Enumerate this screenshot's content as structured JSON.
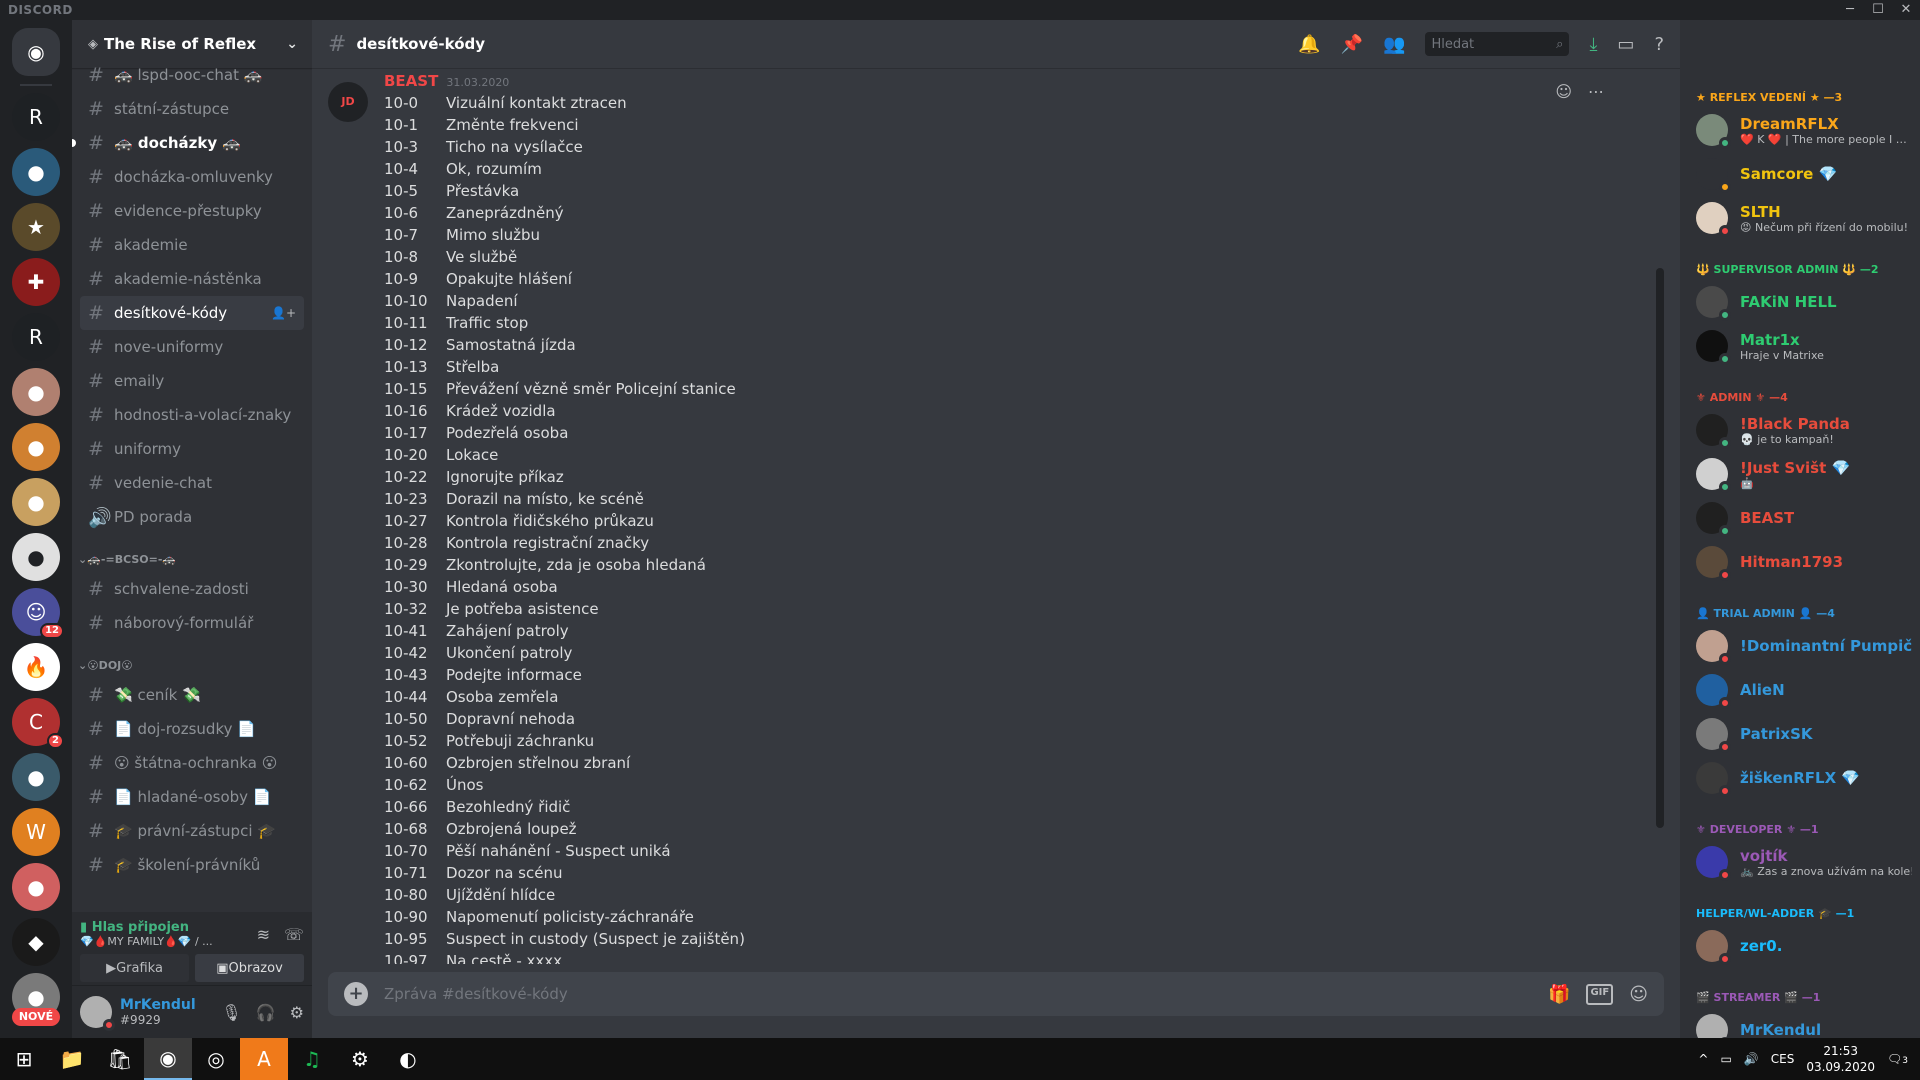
{
  "app": {
    "brand": "DISCORD",
    "window_controls": [
      "─",
      "☐",
      "✕"
    ]
  },
  "servers": [
    {
      "icon": "discord-home",
      "glyph": "◉",
      "bg": "#36393f",
      "badge": ""
    },
    {
      "icon": "reflex-roleplay",
      "glyph": "R",
      "bg": "#1e2124",
      "badge": ""
    },
    {
      "icon": "earth",
      "glyph": "●",
      "bg": "#2a5a7a",
      "badge": ""
    },
    {
      "icon": "sheriff-star",
      "glyph": "★",
      "bg": "#5a4a2a",
      "badge": ""
    },
    {
      "icon": "fire-dept",
      "glyph": "✚",
      "bg": "#8a1c1c",
      "badge": ""
    },
    {
      "icon": "reflex-roleplay-2",
      "glyph": "R",
      "bg": "#1e2124",
      "badge": ""
    },
    {
      "icon": "pizza",
      "glyph": "●",
      "bg": "#b08070",
      "badge": ""
    },
    {
      "icon": "colorful",
      "glyph": "●",
      "bg": "#d08030",
      "badge": ""
    },
    {
      "icon": "doge",
      "glyph": "●",
      "bg": "#c8a060",
      "badge": ""
    },
    {
      "icon": "dog",
      "glyph": "●",
      "bg": "#e0e0e0",
      "badge": ""
    },
    {
      "icon": "group",
      "glyph": "☺",
      "bg": "#4a4e9a",
      "badge": "12"
    },
    {
      "icon": "fire",
      "glyph": "🔥",
      "bg": "#ffffff",
      "badge": ""
    },
    {
      "icon": "code",
      "glyph": "C",
      "bg": "#b03030",
      "badge": "2"
    },
    {
      "icon": "city",
      "glyph": "●",
      "bg": "#3a5a6a",
      "badge": ""
    },
    {
      "icon": "orange-w",
      "glyph": "W",
      "bg": "#e08020",
      "badge": ""
    },
    {
      "icon": "sunset",
      "glyph": "●",
      "bg": "#d06060",
      "badge": ""
    },
    {
      "icon": "diamond",
      "glyph": "◆",
      "bg": "#1a1a1a",
      "badge": ""
    },
    {
      "icon": "new",
      "glyph": "●",
      "bg": "#7a7a7a",
      "badge": ""
    }
  ],
  "new_label": "NOVÉ",
  "guild": {
    "name": "The Rise of Reflex"
  },
  "channels": [
    {
      "type": "text",
      "label": "🚓 lspd-ooc-chat 🚓",
      "state": ""
    },
    {
      "type": "text",
      "label": "státní-zástupce",
      "state": ""
    },
    {
      "type": "text",
      "label": "🚓 docházky 🚓",
      "state": "unread"
    },
    {
      "type": "text",
      "label": "docházka-omluvenky",
      "state": ""
    },
    {
      "type": "text",
      "label": "evidence-přestupky",
      "state": ""
    },
    {
      "type": "text",
      "label": "akademie",
      "state": ""
    },
    {
      "type": "text",
      "label": "akademie-nástěnka",
      "state": ""
    },
    {
      "type": "text",
      "label": "desítkové-kódy",
      "state": "active"
    },
    {
      "type": "text",
      "label": "nove-uniformy",
      "state": ""
    },
    {
      "type": "text",
      "label": "emaily",
      "state": ""
    },
    {
      "type": "text",
      "label": "hodnosti-a-volací-znaky",
      "state": ""
    },
    {
      "type": "text",
      "label": "uniformy",
      "state": ""
    },
    {
      "type": "text",
      "label": "vedenie-chat",
      "state": ""
    },
    {
      "type": "voice",
      "label": "PD porada",
      "state": ""
    },
    {
      "type": "category",
      "label": "🚓-=BCSO=-🚓",
      "state": ""
    },
    {
      "type": "text",
      "label": "schvalene-zadosti",
      "state": ""
    },
    {
      "type": "text",
      "label": "náborový-formulář",
      "state": ""
    },
    {
      "type": "category",
      "label": "😮DOJ😮",
      "state": ""
    },
    {
      "type": "text",
      "label": "💸 ceník 💸",
      "state": ""
    },
    {
      "type": "text",
      "label": "📄 doj-rozsudky 📄",
      "state": ""
    },
    {
      "type": "text",
      "label": "😮 štátna-ochranka 😮",
      "state": ""
    },
    {
      "type": "text",
      "label": "📄 hladané-osoby 📄",
      "state": ""
    },
    {
      "type": "text",
      "label": "🎓 právní-zástupci 🎓",
      "state": ""
    },
    {
      "type": "text",
      "label": "🎓 školení-právníků",
      "state": ""
    }
  ],
  "voice": {
    "status": "Hlas připojen",
    "channel": "💎🩸MY FAMILY🩸💎 / ...",
    "btn_video": "Grafika",
    "btn_screen": "Obrazov"
  },
  "user": {
    "name": "MrKendul",
    "tag": "#9929"
  },
  "channel_header": {
    "name": "desítkové-kódy",
    "search_placeholder": "Hledat"
  },
  "message": {
    "author": "BEAST",
    "author_color": "#f04747",
    "timestamp": "31.03.2020",
    "avatar_text": "JD",
    "lines": [
      [
        "10-0",
        "Vizuální kontakt ztracen"
      ],
      [
        "10-1",
        "Změnte frekvenci"
      ],
      [
        "10-3",
        "Ticho na vysílačce"
      ],
      [
        "10-4",
        "Ok, rozumím"
      ],
      [
        "10-5",
        "Přestávka"
      ],
      [
        "10-6",
        "Zaneprázdněný"
      ],
      [
        "10-7",
        "Mimo službu"
      ],
      [
        "10-8",
        "Ve službě"
      ],
      [
        "10-9",
        "Opakujte hlášení"
      ],
      [
        "10-10",
        "Napadení"
      ],
      [
        "10-11",
        "Traffic stop"
      ],
      [
        "10-12",
        "Samostatná jízda"
      ],
      [
        "10-13",
        "Střelba"
      ],
      [
        "10-15",
        "Převážení vězně směr Policejní stanice"
      ],
      [
        "10-16",
        "Krádež vozidla"
      ],
      [
        "10-17",
        "Podezřelá osoba"
      ],
      [
        "10-20",
        "Lokace"
      ],
      [
        "10-22",
        "Ignorujte příkaz"
      ],
      [
        "10-23",
        "Dorazil na místo, ke scéně"
      ],
      [
        "10-27",
        "Kontrola řidičského průkazu"
      ],
      [
        "10-28",
        "Kontrola registrační značky"
      ],
      [
        "10-29",
        "Zkontrolujte, zda je osoba hledaná"
      ],
      [
        "10-30",
        "Hledaná osoba"
      ],
      [
        "10-32",
        "Je potřeba asistence"
      ],
      [
        "10-41",
        "Zahájení patroly"
      ],
      [
        "10-42",
        "Ukončení patroly"
      ],
      [
        "10-43",
        "Podejte informace"
      ],
      [
        "10-44",
        "Osoba zemřela"
      ],
      [
        "10-50",
        "Dopravní nehoda"
      ],
      [
        "10-52",
        "Potřebuji záchranku"
      ],
      [
        "10-60",
        "Ozbrojen střelnou zbraní"
      ],
      [
        "10-62",
        "Únos"
      ],
      [
        "10-66",
        "Bezohledný řidič"
      ],
      [
        "10-68",
        "Ozbrojená loupež"
      ],
      [
        "10-70",
        "Pěší nahánění - Suspect uniká"
      ],
      [
        "10-71",
        "Dozor na scénu"
      ],
      [
        "10-80",
        "Ujíždění hlídce"
      ],
      [
        "10-90",
        "Napomenutí policisty-záchranáře"
      ],
      [
        "10-95",
        "Suspect in custody (Suspect je zajištěn)"
      ],
      [
        "10-97",
        "Na cestě - xxxx"
      ]
    ]
  },
  "composer": {
    "placeholder": "Zpráva #desítkové-kódy",
    "gif_label": "GIF"
  },
  "members": [
    {
      "role": "★ REFLEX VEDENÍ ★ —3",
      "role_color": "#faa61a",
      "people": [
        {
          "name": "DreamRFLX",
          "color": "#faa61a",
          "activity": "❤️ K ❤️ | The more people I m...",
          "status": "online",
          "avatar_bg": "#7a8a7a"
        },
        {
          "name": "Samcore 💎",
          "color": "#f1c40f",
          "activity": "",
          "status": "idle",
          "avatar_bg": "#2f3136"
        },
        {
          "name": "SLTH",
          "color": "#f1c40f",
          "activity": "😡 Nečum při řízení do mobilu!",
          "status": "dnd",
          "avatar_bg": "#e0d0c0"
        }
      ]
    },
    {
      "role": "🔱 SUPERVISOR ADMIN 🔱 —2",
      "role_color": "#2ecc71",
      "people": [
        {
          "name": "FAKiN HELL",
          "color": "#2ecc71",
          "activity": "",
          "status": "online",
          "avatar_bg": "#4a4a4a"
        },
        {
          "name": "Matr1x",
          "color": "#2ecc71",
          "activity": "Hraje v Matrixe",
          "status": "online",
          "avatar_bg": "#101010"
        }
      ]
    },
    {
      "role": "⚜ ADMIN ⚜ —4",
      "role_color": "#e74c3c",
      "people": [
        {
          "name": "!Black Panda",
          "color": "#e74c3c",
          "activity": "💀 je to kampaň!",
          "status": "online",
          "avatar_bg": "#202020"
        },
        {
          "name": "!Just Svišt 💎",
          "color": "#e74c3c",
          "activity": "🤖",
          "status": "online",
          "avatar_bg": "#d0d0d0"
        },
        {
          "name": "BEAST",
          "color": "#e74c3c",
          "activity": "",
          "status": "online",
          "avatar_bg": "#202020"
        },
        {
          "name": "Hitman1793",
          "color": "#e74c3c",
          "activity": "",
          "status": "dnd",
          "avatar_bg": "#5a4a3a"
        }
      ]
    },
    {
      "role": "👤 TRIAL ADMIN 👤 —4",
      "role_color": "#3498db",
      "people": [
        {
          "name": "!Dominantní Pumpič 💎",
          "color": "#3498db",
          "activity": "",
          "status": "dnd",
          "avatar_bg": "#c0a090"
        },
        {
          "name": "AlieN",
          "color": "#3498db",
          "activity": "",
          "status": "dnd",
          "avatar_bg": "#2060a0"
        },
        {
          "name": "PatrixSK",
          "color": "#3498db",
          "activity": "",
          "status": "dnd",
          "avatar_bg": "#7a7a7a"
        },
        {
          "name": "žiškenRFLX 💎",
          "color": "#3498db",
          "activity": "",
          "status": "dnd",
          "avatar_bg": "#3a3a3a"
        }
      ]
    },
    {
      "role": "⚜ DEVELOPER ⚜ —1",
      "role_color": "#9b59b6",
      "people": [
        {
          "name": "vojtík",
          "color": "#9b59b6",
          "activity": "🚲 Zas a znova užívám na kole!",
          "status": "dnd",
          "avatar_bg": "#3a3aaa"
        }
      ]
    },
    {
      "role": "HELPER/WL-ADDER 🎓 —1",
      "role_color": "#1abcfc",
      "people": [
        {
          "name": "zer0.",
          "color": "#1abcfc",
          "activity": "",
          "status": "dnd",
          "avatar_bg": "#8a6a5a"
        }
      ]
    },
    {
      "role": "🎬 STREAMER 🎬 —1",
      "role_color": "#9b59b6",
      "people": [
        {
          "name": "MrKendul",
          "color": "#3498db",
          "activity": "",
          "status": "dnd",
          "avatar_bg": "#b0b0b0"
        }
      ]
    }
  ],
  "taskbar": {
    "apps": [
      "⊞",
      "📁",
      "🛍",
      "◉",
      "◎",
      "A",
      "♫",
      "⚙",
      "◐"
    ],
    "lang": "CES",
    "time": "21:53",
    "date": "03.09.2020",
    "notif": "3"
  }
}
